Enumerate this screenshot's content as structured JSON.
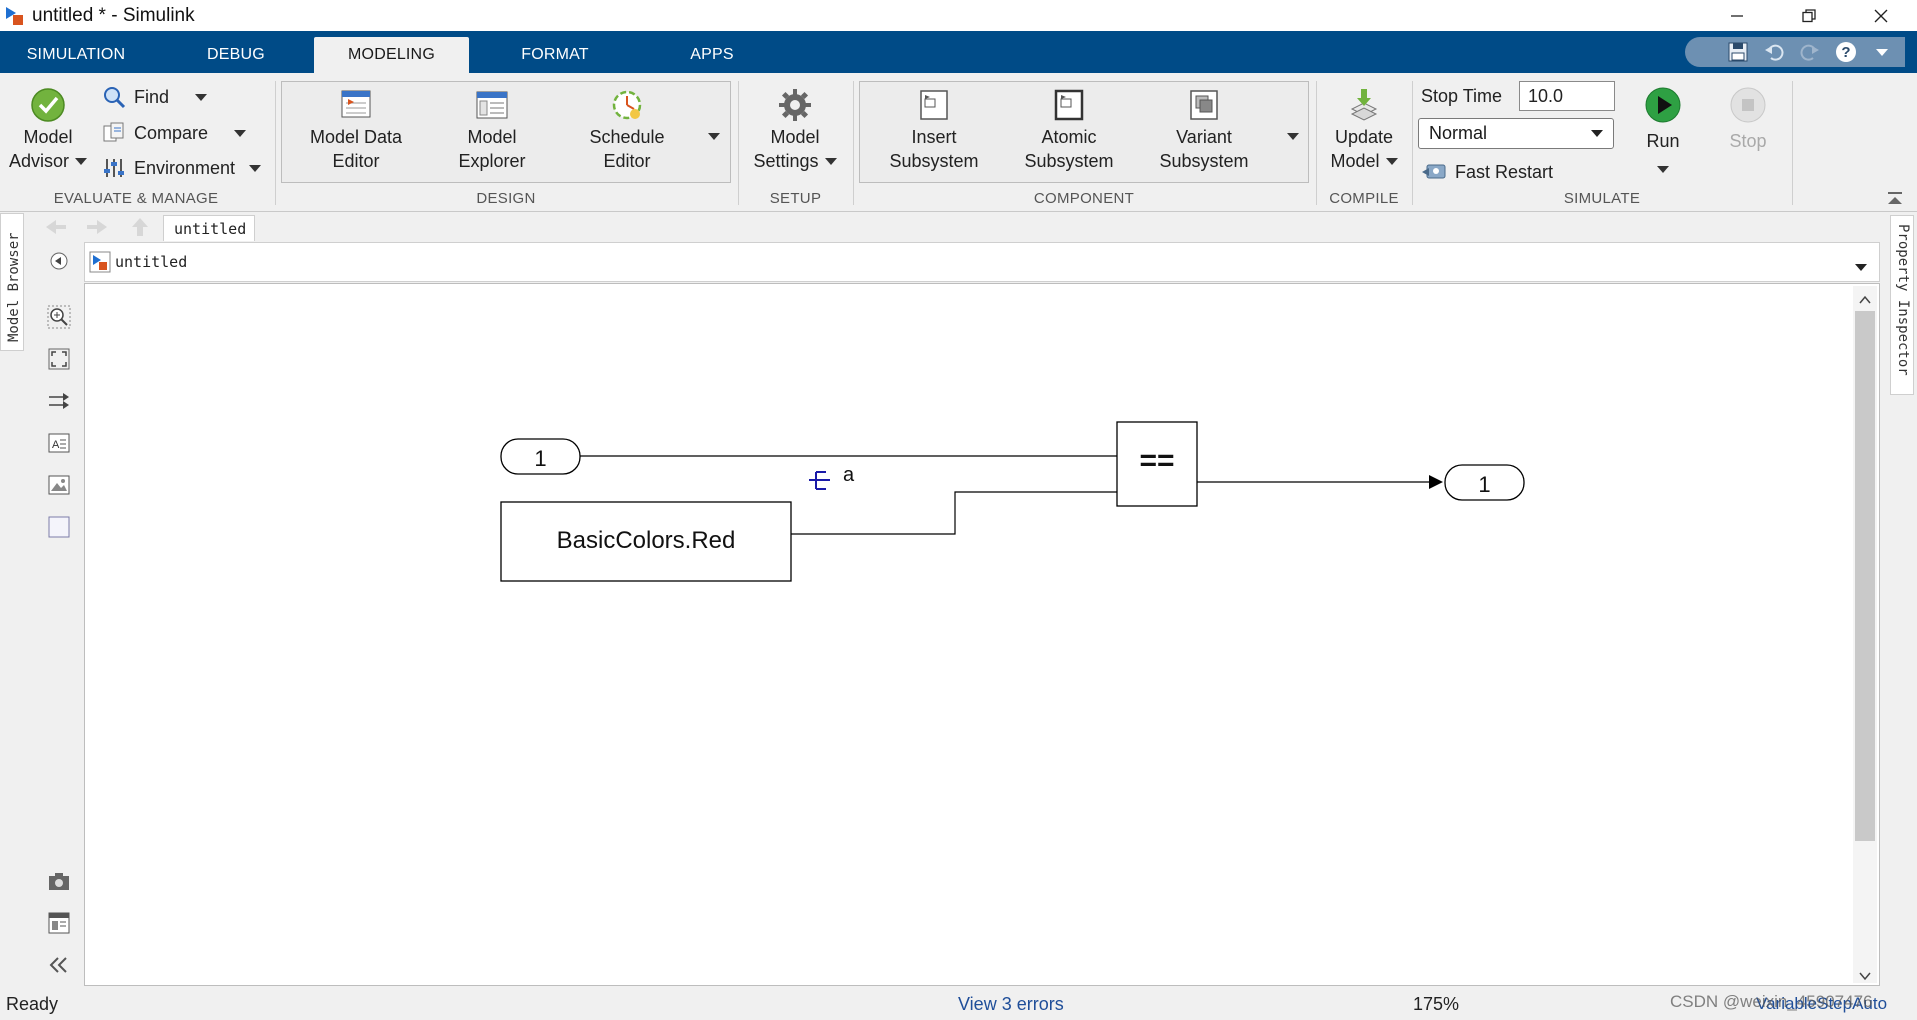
{
  "window": {
    "title": "untitled * - Simulink",
    "controls": {
      "minimize": "minimize-icon",
      "restore": "restore-icon",
      "close": "close-icon"
    }
  },
  "tabs": [
    {
      "label": "SIMULATION"
    },
    {
      "label": "DEBUG"
    },
    {
      "label": "MODELING"
    },
    {
      "label": "FORMAT"
    },
    {
      "label": "APPS"
    }
  ],
  "active_tab": "MODELING",
  "ribbon": {
    "evaluate": {
      "label": "EVALUATE & MANAGE",
      "model_advisor_line1": "Model",
      "model_advisor_line2": "Advisor",
      "find": "Find",
      "compare": "Compare",
      "environment": "Environment"
    },
    "design": {
      "label": "DESIGN",
      "model_data_editor_1": "Model Data",
      "model_data_editor_2": "Editor",
      "model_explorer_1": "Model",
      "model_explorer_2": "Explorer",
      "schedule_editor_1": "Schedule",
      "schedule_editor_2": "Editor"
    },
    "setup": {
      "label": "SETUP",
      "model_settings_1": "Model",
      "model_settings_2": "Settings"
    },
    "component": {
      "label": "COMPONENT",
      "insert_subsystem_1": "Insert",
      "insert_subsystem_2": "Subsystem",
      "atomic_subsystem_1": "Atomic",
      "atomic_subsystem_2": "Subsystem",
      "variant_subsystem_1": "Variant",
      "variant_subsystem_2": "Subsystem"
    },
    "compile": {
      "label": "COMPILE",
      "update_model_1": "Update",
      "update_model_2": "Model"
    },
    "simulate": {
      "label": "SIMULATE",
      "stop_time_label": "Stop Time",
      "stop_time_value": "10.0",
      "mode": "Normal",
      "fast_restart": "Fast Restart",
      "run": "Run",
      "stop": "Stop"
    }
  },
  "breadcrumb": {
    "tab": "untitled",
    "path": "untitled"
  },
  "side_panels": {
    "left": "Model Browser",
    "right": "Property Inspector"
  },
  "diagram": {
    "inport": {
      "label": "1"
    },
    "outport": {
      "label": "1"
    },
    "relational": {
      "label": "=="
    },
    "constant": {
      "label": "BasicColors.Red"
    },
    "signal_label": "a"
  },
  "status": {
    "state": "Ready",
    "errors": "View 3 errors",
    "zoom": "175%",
    "solver": "VariableStepAuto",
    "watermark": "CSDN @weixin_45907476"
  },
  "colors": {
    "tab_bar": "#004b87",
    "signal_marker": "#1a1aa8",
    "run_green": "#2ea043",
    "link": "#1f4e99"
  }
}
